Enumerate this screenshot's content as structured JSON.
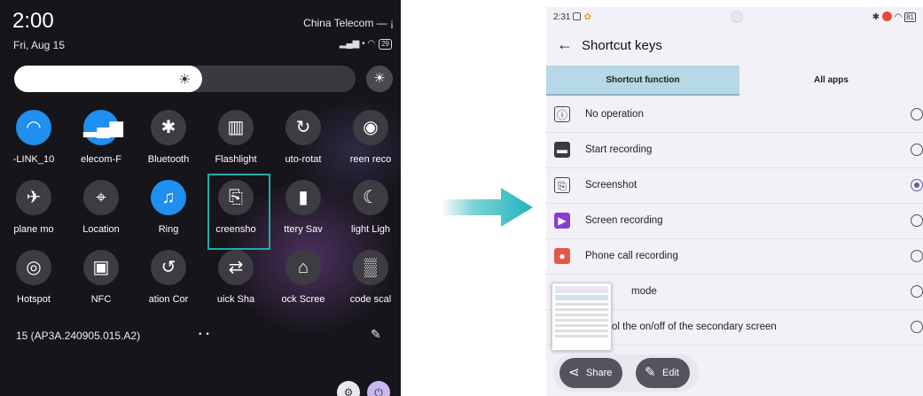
{
  "left": {
    "time": "2:00",
    "date": "Fri, Aug 15",
    "carrier": "China Telecom — ¡",
    "status": "▂▄▆ • ◠",
    "battery": "29",
    "build": "15 (AP3A.240905.015.A2)",
    "dots": "• •",
    "tiles": [
      {
        "label": "-LINK_10",
        "glyph": "◠",
        "on": true
      },
      {
        "label": "elecom-F",
        "glyph": "▂▄▆",
        "on": true
      },
      {
        "label": "Bluetooth",
        "glyph": "✱",
        "on": false
      },
      {
        "label": "Flashlight",
        "glyph": "▥",
        "on": false
      },
      {
        "label": "uto-rotat",
        "glyph": "↻",
        "on": false
      },
      {
        "label": "reen reco",
        "glyph": "◉",
        "on": false
      },
      {
        "label": "plane mo",
        "glyph": "✈",
        "on": false
      },
      {
        "label": "Location",
        "glyph": "⌖",
        "on": false
      },
      {
        "label": "Ring",
        "glyph": "♫",
        "on": true
      },
      {
        "label": "creensho",
        "glyph": "⎘",
        "on": false
      },
      {
        "label": "ttery Sav",
        "glyph": "▮",
        "on": false
      },
      {
        "label": "light Ligh",
        "glyph": "☾",
        "on": false
      },
      {
        "label": "Hotspot",
        "glyph": "◎",
        "on": false
      },
      {
        "label": "NFC",
        "glyph": "▣",
        "on": false
      },
      {
        "label": "ation Cor",
        "glyph": "↺",
        "on": false
      },
      {
        "label": "uick Sha",
        "glyph": "⇄",
        "on": false
      },
      {
        "label": "ock Scree",
        "glyph": "⌂",
        "on": false
      },
      {
        "label": "code scal",
        "glyph": "▒",
        "on": false
      }
    ]
  },
  "right": {
    "time": "2:31",
    "battery": "81",
    "title": "Shortcut keys",
    "tabs": [
      "Shortcut function",
      "All apps"
    ],
    "rows": [
      {
        "label": "No operation",
        "icon": "info-icon",
        "glyph": "ⓘ",
        "color": "#ffffff",
        "selected": false
      },
      {
        "label": "Start recording",
        "icon": "recorder-icon",
        "glyph": "▬",
        "color": "#3a3a44",
        "selected": false
      },
      {
        "label": "Screenshot",
        "icon": "screenshot-icon",
        "glyph": "⎘",
        "color": "#ffffff",
        "selected": true
      },
      {
        "label": "Screen recording",
        "icon": "screen-recording-icon",
        "glyph": "▶",
        "color": "#8a3bd6",
        "selected": false
      },
      {
        "label": "Phone call recording",
        "icon": "call-recording-icon",
        "glyph": "●",
        "color": "#e05a4a",
        "selected": false
      },
      {
        "label": "mode",
        "icon": "mode-icon",
        "glyph": "▢",
        "color": "#ffffff",
        "selected": false
      },
      {
        "label": "ol the on/off of the secondary screen",
        "icon": "secondary-screen-icon",
        "glyph": "□",
        "color": "#ffffff",
        "selected": false
      }
    ],
    "share_label": "Share",
    "edit_label": "Edit"
  }
}
